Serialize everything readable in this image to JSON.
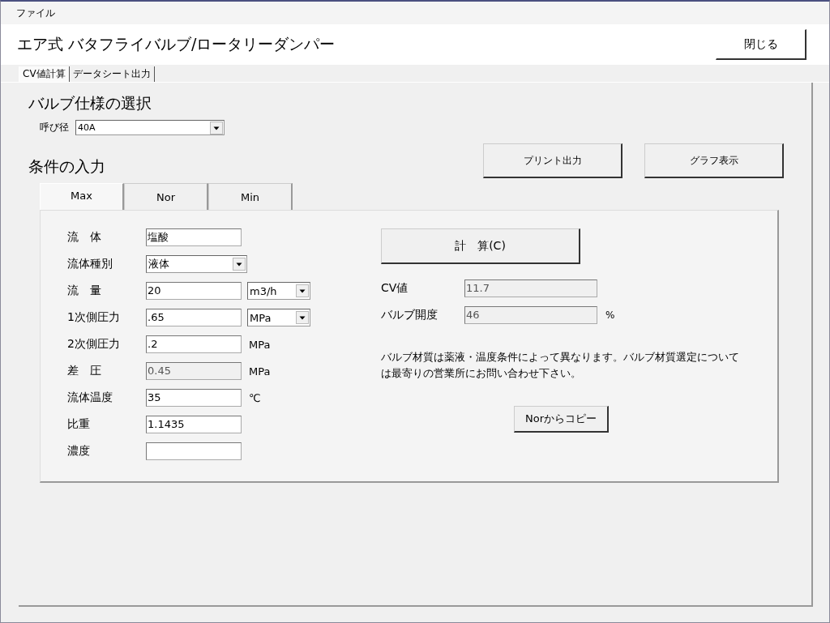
{
  "menu": [
    {
      "label": "ファイル"
    }
  ],
  "title": "エア式 バタフライバルブ/ロータリーダンパー",
  "close_button": "閉じる",
  "tabs": [
    {
      "label": "CV値計算",
      "selected": true
    },
    {
      "label": "データシート出力",
      "selected": false
    }
  ],
  "valve_section": {
    "heading": "バルブ仕様の選択",
    "size_label": "呼び径",
    "size_value": "40A"
  },
  "conditions_section": {
    "heading": "条件の入力",
    "buttons": [
      "プリント出力",
      "グラフ表示"
    ]
  },
  "case_tabs": [
    {
      "label": "Max",
      "selected": true
    },
    {
      "label": "Nor",
      "selected": false
    },
    {
      "label": "Min",
      "selected": false
    }
  ],
  "fields": [
    {
      "label": "流　体",
      "input": {
        "kind": "text",
        "value": "塩酸"
      }
    },
    {
      "label": "流体種別",
      "input": {
        "kind": "select",
        "value": "液体"
      }
    },
    {
      "label": "流　量",
      "input": {
        "kind": "text",
        "value": "20"
      },
      "unit": {
        "kind": "select",
        "value": "m3/h"
      }
    },
    {
      "label": "1次側圧力",
      "input": {
        "kind": "text",
        "value": ".65"
      },
      "unit": {
        "kind": "select",
        "value": "MPa"
      }
    },
    {
      "label": "2次側圧力",
      "input": {
        "kind": "text",
        "value": ".2"
      },
      "unit": {
        "kind": "text",
        "value": "MPa"
      }
    },
    {
      "label": "差　圧",
      "input": {
        "kind": "readonly",
        "value": "0.45"
      },
      "unit": {
        "kind": "text",
        "value": "MPa"
      }
    },
    {
      "label": "流体温度",
      "input": {
        "kind": "text",
        "value": "35"
      },
      "unit": {
        "kind": "text",
        "value": "℃"
      }
    },
    {
      "label": "比重",
      "input": {
        "kind": "text",
        "value": "1.1435"
      }
    },
    {
      "label": "濃度",
      "input": {
        "kind": "text"
      }
    }
  ],
  "calc_button": "計　算(C)",
  "results": [
    {
      "label": "CV値",
      "value": "11.7"
    },
    {
      "label": "バルブ開度",
      "value": "46",
      "unit": "%"
    }
  ],
  "note": "バルブ材質は薬液・温度条件によって異なります。バルブ材質選定については最寄りの営業所にお問い合わせ下さい。",
  "copy_button": "Norからコピー"
}
